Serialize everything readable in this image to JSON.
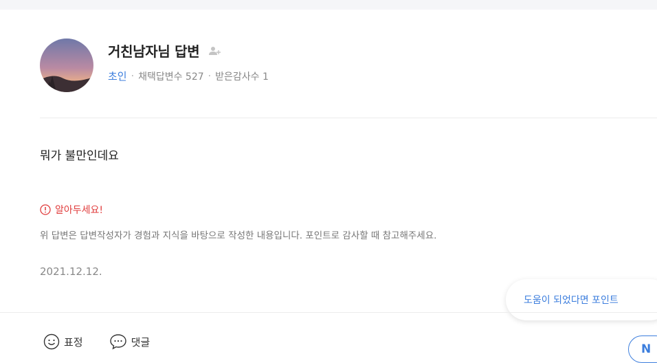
{
  "profile": {
    "name": "거친남자님 답변",
    "grade": "초인",
    "stats": [
      "채택답변수 527",
      "받은감사수 1"
    ],
    "avatar_icon": "sunset-landscape-avatar",
    "follow_icon": "add-user-icon"
  },
  "answer": {
    "body": "뭐가 불만인데요"
  },
  "notice": {
    "title": "알아두세요!",
    "icon": "alert-circle-icon",
    "text": "위 답변은 답변작성자가 경험과 지식을 바탕으로 작성한 내용입니다. 포인트로 감사할 때 참고해주세요."
  },
  "date": "2021.12.12.",
  "point_prompt": "도움이 되었다면 포인트",
  "actions": {
    "emotion_label": "표정",
    "comment_label": "댓글",
    "n_button_label": "N"
  },
  "colors": {
    "accent": "#3b7ddd",
    "alert": "#e03b3b",
    "text": "#222222",
    "muted": "#888888"
  }
}
